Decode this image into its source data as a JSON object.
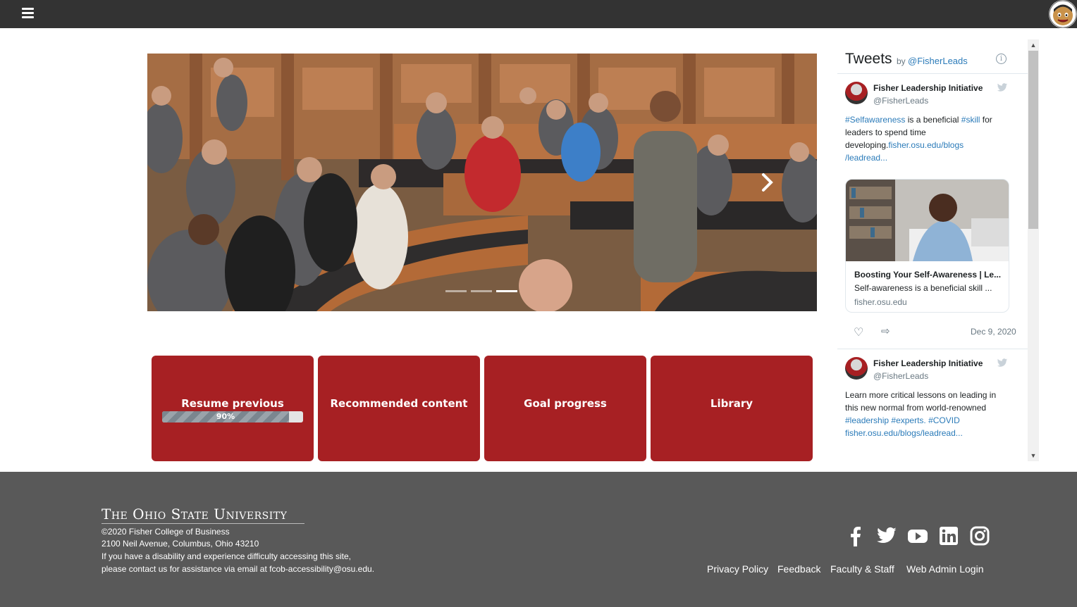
{
  "topbar": {
    "menu_icon": "hamburger-menu-icon",
    "avatar_icon": "brutus-mascot-icon"
  },
  "carousel": {
    "slide_count": 3,
    "active_index": 2,
    "next_icon": "chevron-right-icon"
  },
  "tiles": [
    {
      "label": "Resume previous",
      "progress_text": "90%",
      "progress": 0.9
    },
    {
      "label": "Recommended content"
    },
    {
      "label": "Goal progress"
    },
    {
      "label": "Library"
    }
  ],
  "tweets": {
    "title": "Tweets",
    "by": "by",
    "handle_link": "@FisherLeads",
    "items": [
      {
        "name": "Fisher Leadership Initiative",
        "handle": "@FisherLeads",
        "text_parts": [
          "#Selfawareness",
          " is a beneficial ",
          "#skill",
          " for leaders to spend time developing.",
          "fisher.osu.edu/blogs",
          "/leadread..."
        ],
        "card": {
          "title": "Boosting Your Self-Awareness | Le...",
          "desc": "Self-awareness is a beneficial skill ...",
          "domain": "fisher.osu.edu"
        },
        "date": "Dec 9, 2020"
      },
      {
        "name": "Fisher Leadership Initiative",
        "handle": "@FisherLeads",
        "text_parts": [
          "Learn more critical lessons on leading in this new normal from world-renowned ",
          "#leadership",
          " ",
          "#experts",
          ". ",
          "#COVID",
          " ",
          "fisher.osu.edu/blogs/leadread..."
        ]
      }
    ]
  },
  "footer": {
    "university": "The Ohio State University",
    "copyright": "©2020 Fisher College of Business",
    "address": "2100 Neil Avenue, Columbus, Ohio 43210",
    "access1": "If you have a disability and experience difficulty accessing this site,",
    "access2": "please contact us for assistance via email at fcob-accessibility@osu.edu.",
    "links": [
      "Privacy Policy",
      "Feedback",
      "Faculty & Staff",
      "Web Admin Login"
    ],
    "social": [
      "facebook-icon",
      "twitter-icon",
      "youtube-icon",
      "linkedin-icon",
      "instagram-icon"
    ]
  },
  "colors": {
    "topbar": "#333333",
    "tile": "#a72023",
    "footer": "#595959",
    "link": "#2b7bb9"
  }
}
